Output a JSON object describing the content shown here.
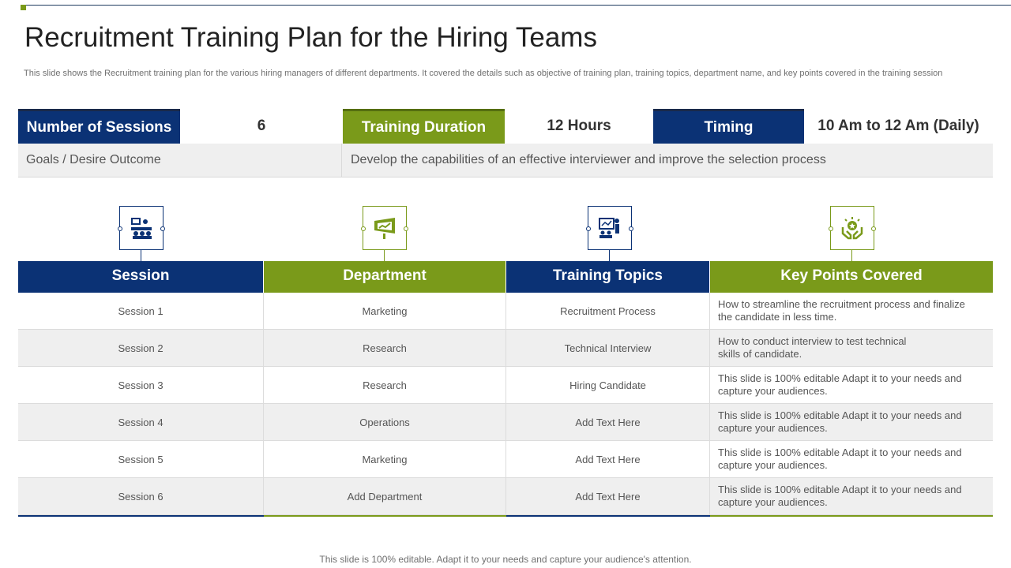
{
  "title": "Recruitment Training Plan for the Hiring Teams",
  "subtitle": "This slide shows the Recruitment training plan for the various hiring managers of different departments. It covered the details such as objective of training plan, training topics, department name, and key points covered in the training session",
  "info": {
    "sessions_label": "Number of Sessions",
    "sessions_value": "6",
    "duration_label": "Training Duration",
    "duration_value": "12 Hours",
    "timing_label": "Timing",
    "timing_value": "10 Am to 12 Am (Daily)",
    "goal_label": "Goals / Desire Outcome",
    "goal_value": "Develop the capabilities of an effective interviewer and improve the selection process"
  },
  "icons": [
    "meeting-icon",
    "presentation-icon",
    "training-icon",
    "award-hands-icon"
  ],
  "colors": {
    "blue": "#0b3275",
    "green": "#7a9a1a"
  },
  "table": {
    "headers": [
      "Session",
      "Department",
      "Training Topics",
      "Key Points Covered"
    ],
    "rows": [
      [
        "Session 1",
        "Marketing",
        "Recruitment Process",
        "How to streamline the recruitment process and finalize the candidate in less time."
      ],
      [
        "Session 2",
        "Research",
        "Technical Interview",
        "How to conduct interview  to test technical skills of candidate."
      ],
      [
        "Session 3",
        "Research",
        "Hiring Candidate",
        "This slide is 100% editable Adapt it to your needs and capture your audiences."
      ],
      [
        "Session 4",
        "Operations",
        "Add Text Here",
        "This slide is 100% editable Adapt it to your needs and capture your audiences."
      ],
      [
        "Session 5",
        "Marketing",
        "Add Text Here",
        "This slide is 100% editable Adapt it to your needs and capture your audiences."
      ],
      [
        "Session 6",
        "Add Department",
        "Add Text Here",
        "This slide is 100% editable Adapt it to your needs and capture your audiences."
      ]
    ]
  },
  "footer": "This slide is 100% editable. Adapt it to your needs and capture your audience's attention."
}
